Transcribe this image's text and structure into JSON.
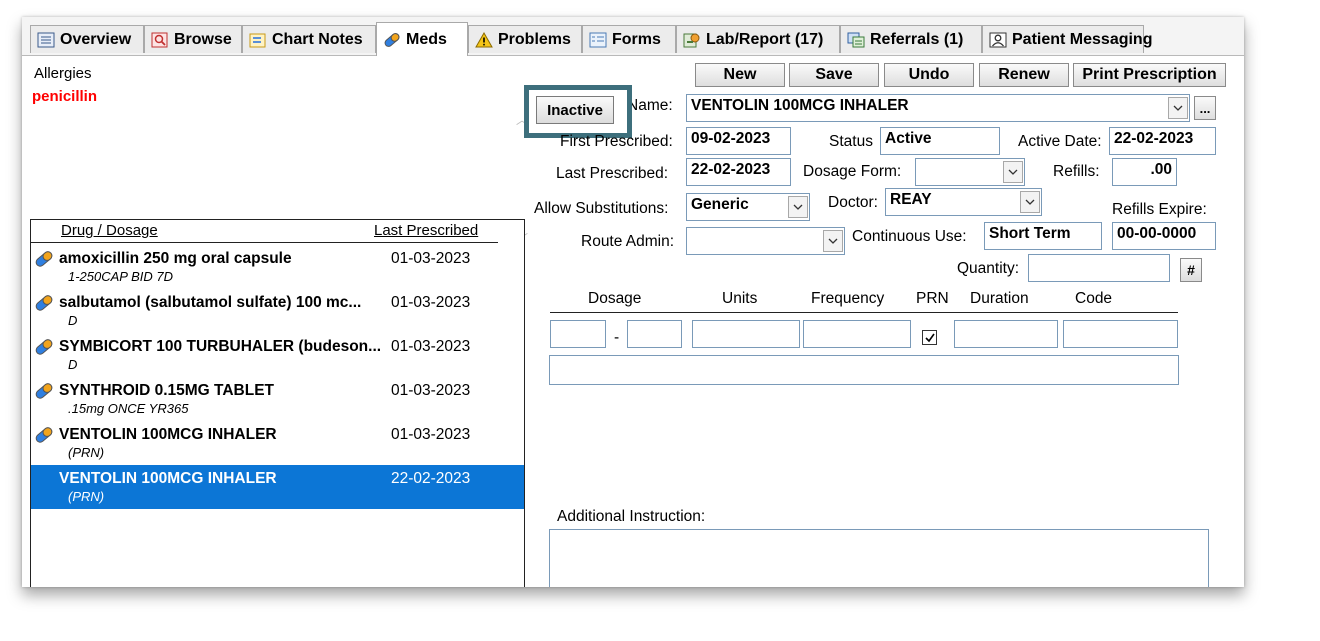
{
  "tabs": [
    {
      "label": "Overview",
      "icon": "overview-icon"
    },
    {
      "label": "Browse",
      "icon": "browse-icon"
    },
    {
      "label": "Chart Notes",
      "icon": "chart-notes-icon"
    },
    {
      "label": "Meds",
      "icon": "pill-icon"
    },
    {
      "label": "Problems",
      "icon": "warning-icon"
    },
    {
      "label": "Forms",
      "icon": "forms-icon"
    },
    {
      "label": "Lab/Report (17)",
      "icon": "lab-report-icon"
    },
    {
      "label": "Referrals (1)",
      "icon": "referrals-icon"
    },
    {
      "label": "Patient Messaging",
      "icon": "patient-messaging-icon"
    }
  ],
  "allergies": {
    "label": "Allergies",
    "value": "penicillin"
  },
  "drug_list": {
    "headers": {
      "drug": "Drug / Dosage",
      "date": "Last Prescribed"
    },
    "rows": [
      {
        "name": "amoxicillin 250 mg oral capsule",
        "date": "01-03-2023",
        "sub": "1-250CAP BID 7D",
        "icon": true
      },
      {
        "name": "salbutamol (salbutamol sulfate) 100 mc...",
        "date": "01-03-2023",
        "sub": "D",
        "icon": true
      },
      {
        "name": "SYMBICORT 100 TURBUHALER (budeson...",
        "date": "01-03-2023",
        "sub": "D",
        "icon": true
      },
      {
        "name": "SYNTHROID 0.15MG TABLET",
        "date": "01-03-2023",
        "sub": ".15mg ONCE YR365",
        "icon": true
      },
      {
        "name": "VENTOLIN 100MCG INHALER",
        "date": "01-03-2023",
        "sub": "(PRN)",
        "icon": true
      },
      {
        "name": "VENTOLIN 100MCG INHALER",
        "date": "22-02-2023",
        "sub": "(PRN)",
        "icon": false,
        "selected": true
      }
    ]
  },
  "toolbar": {
    "new": "New",
    "save": "Save",
    "undo": "Undo",
    "renew": "Renew",
    "print": "Print Prescription",
    "inactive": "Inactive"
  },
  "form": {
    "name_label": "Name:",
    "name_value": "VENTOLIN 100MCG INHALER",
    "ellipsis": "...",
    "first_prescribed_label": "First Prescribed:",
    "first_prescribed_value": "09-02-2023",
    "status_label": "Status",
    "status_value": "Active",
    "active_date_label": "Active Date:",
    "active_date_value": "22-02-2023",
    "last_prescribed_label": "Last Prescribed:",
    "last_prescribed_value": "22-02-2023",
    "dosage_form_label": "Dosage Form:",
    "dosage_form_value": "",
    "refills_label": "Refills:",
    "refills_value": ".00",
    "allow_subs_label": "Allow Substitutions:",
    "allow_subs_value": "Generic",
    "doctor_label": "Doctor:",
    "doctor_value": "REAY",
    "refills_expire_label": "Refills Expire:",
    "refills_expire_value": "00-00-0000",
    "route_admin_label": "Route Admin:",
    "route_admin_value": "",
    "continuous_use_label": "Continuous Use:",
    "continuous_use_value": "Short Term",
    "quantity_label": "Quantity:",
    "quantity_value": "",
    "hash_button": "#",
    "dosage_headers": [
      "Dosage",
      "Units",
      "Frequency",
      "PRN",
      "Duration",
      "Code"
    ],
    "dosage_dash": "-",
    "prn_checked": true,
    "checkmark": "☑",
    "additional_instruction_label": "Additional Instruction:"
  }
}
